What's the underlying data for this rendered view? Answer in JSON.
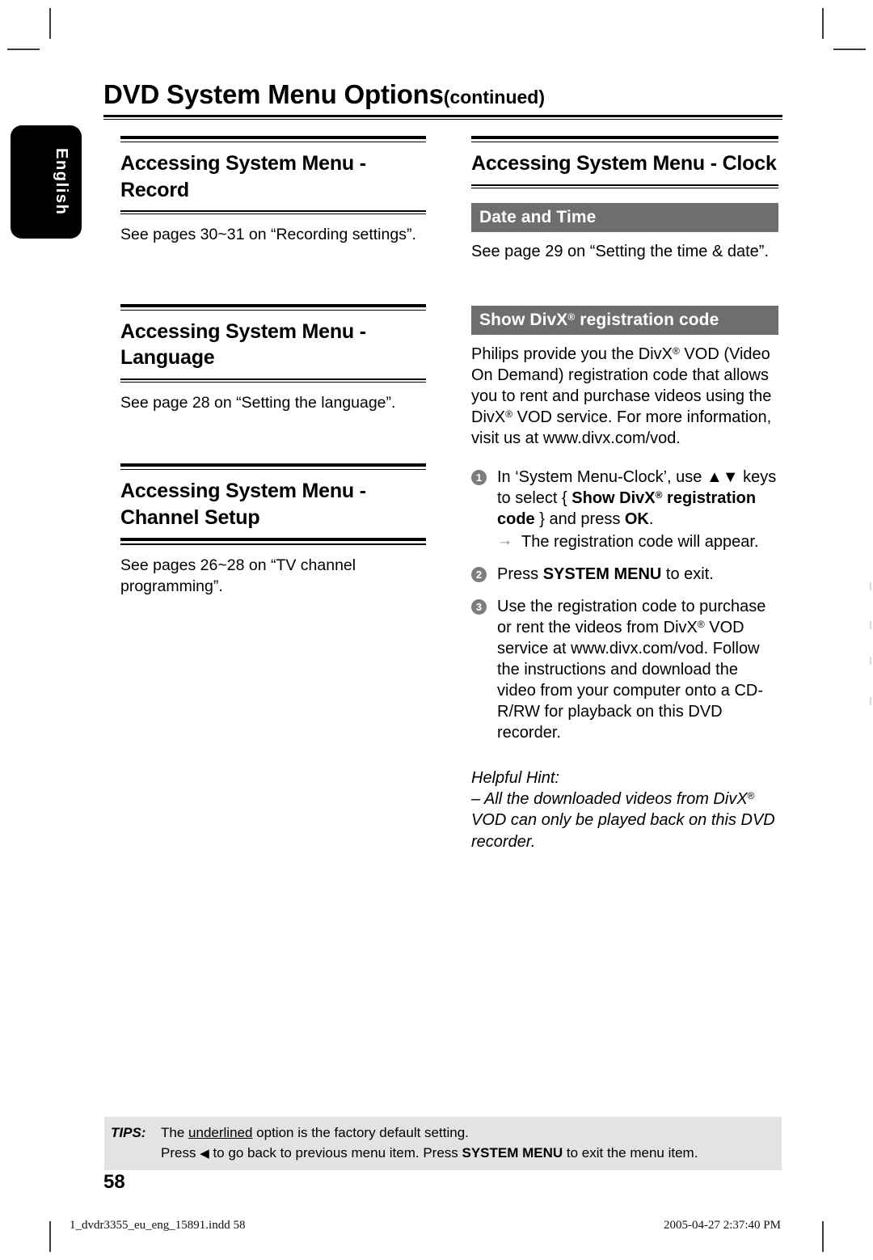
{
  "page": {
    "title_main": "DVD System Menu Options",
    "title_continued": "(continued)",
    "language_tab": "English",
    "page_number": "58"
  },
  "left_column": {
    "sections": [
      {
        "heading": "Accessing System Menu - Record",
        "body": "See pages 30~31 on “Recording settings”."
      },
      {
        "heading": "Accessing System Menu - Language",
        "body": "See page 28 on “Setting the language”."
      },
      {
        "heading": "Accessing System Menu - Channel Setup",
        "body": "See pages 26~28 on “TV channel programming”."
      }
    ]
  },
  "right_column": {
    "heading": "Accessing System Menu - Clock",
    "banner_date_time": "Date and Time",
    "date_time_body": "See page 29 on “Setting the time & date”.",
    "banner_divx_prefix": "Show DivX",
    "banner_divx_reg": "®",
    "banner_divx_suffix": " registration code",
    "divx_paragraph_1": "Philips provide you the DivX",
    "divx_paragraph_2": " VOD (Video On Demand) registration code that allows you to rent and purchase videos using the DivX",
    "divx_paragraph_3": " VOD service. For more information, visit us at www.divx.com/vod.",
    "steps": [
      {
        "number": "1",
        "text_a": "In ‘System Menu-Clock’, use ▲▼ keys to select { ",
        "bold_a": "Show DivX",
        "reg": "®",
        "bold_b": " registration code",
        "text_b": " } and press ",
        "bold_c": "OK",
        "text_c": ".",
        "substep_arrow": "→",
        "substep": "The registration code will appear."
      },
      {
        "number": "2",
        "text_a": "Press ",
        "bold_a": "SYSTEM MENU",
        "text_b": " to exit."
      },
      {
        "number": "3",
        "text_a": "Use the registration code to purchase or rent the videos from DivX",
        "reg": "®",
        "text_b": " VOD service at www.divx.com/vod. Follow the instructions and download the video from your computer onto a CD-R/RW for playback on this DVD recorder."
      }
    ],
    "hint_title": "Helpful Hint:",
    "hint_line_a": "– All the downloaded videos from DivX",
    "hint_reg": "®",
    "hint_line_b": " VOD can only be played back on this DVD recorder."
  },
  "tips": {
    "label": "TIPS:",
    "line1_a": "The ",
    "line1_underline": "underlined",
    "line1_b": " option is the factory default setting.",
    "line2_a": "Press ",
    "line2_tri": "◀",
    "line2_b": " to go back to previous menu item. Press ",
    "line2_bold": "SYSTEM MENU",
    "line2_c": " to exit the menu item."
  },
  "print_footer": {
    "filename": "1_dvdr3355_eu_eng_15891.indd   58",
    "timestamp": "2005-04-27   2:37:40 PM"
  },
  "colors": {
    "banner_gray": "#6e6e6e",
    "step_bullet_gray": "#7d7d7d",
    "tips_background": "#e3e3e3",
    "rule_black": "#000000"
  }
}
